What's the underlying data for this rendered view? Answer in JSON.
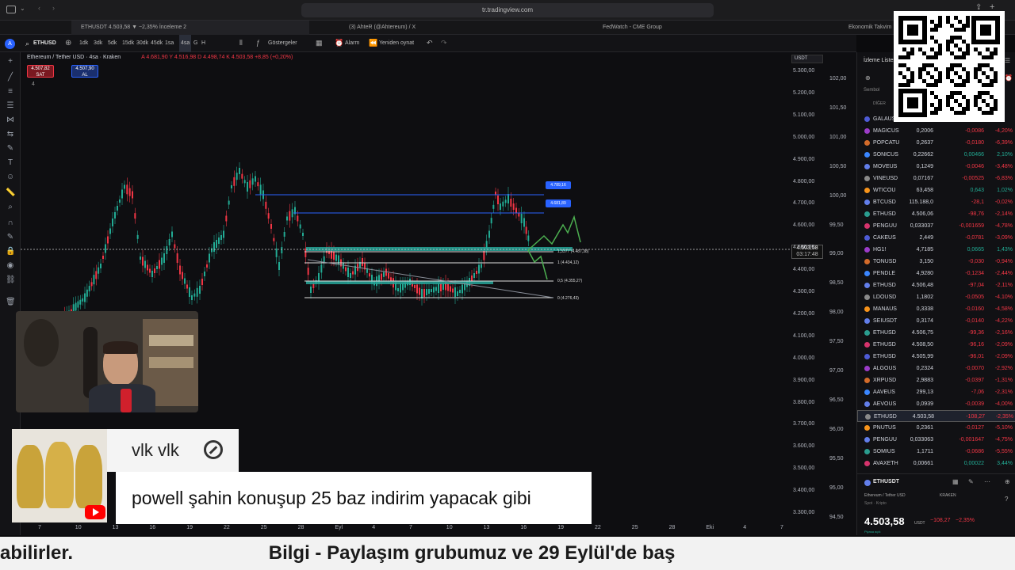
{
  "browser": {
    "url": "tr.tradingview.com",
    "tabs": [
      "ETHUSDT 4.503,58 ▼ −2,35% İnceleme 2",
      "(3) AhteR (@Ahtereum) / X",
      "FedWatch - CME Group",
      "Ekonomik Takvim"
    ]
  },
  "toolbar": {
    "symbol": "ETHUSD",
    "intervals": [
      "1dk",
      "3dk",
      "5dk",
      "15dk",
      "30dk",
      "45dk",
      "1sa",
      "4sa",
      "G",
      "H"
    ],
    "active_interval": "4sa",
    "indicators_label": "Göstergeler",
    "alarm_label": "Alarm",
    "replay_label": "Yeniden oynat"
  },
  "chart": {
    "title": "Ethereum / Tether USD · 4sa · Kraken",
    "ohlc": "A 4.681,90 Y 4.516,98 D 4.498,74 K 4.503,58 +8,85 (+0,20%)",
    "sell_price": "4.507,82",
    "sell_label": "SAT",
    "buy_price": "4.507,90",
    "buy_label": "AL",
    "vol_label": "4",
    "currency_select": "USDT",
    "current_price": "4.503,58",
    "countdown": "03:17:48",
    "upper_badge_1": "4.789,16",
    "upper_badge_2": "4.681,89",
    "fib_labels": [
      "1,3377 (4.487,38)",
      "1 (4.434,12)",
      "0,5 (4.355,27)",
      "0 (4.276,43)"
    ],
    "price_axis": [
      "5.300,00",
      "5.200,00",
      "5.100,00",
      "5.000,00",
      "4.900,00",
      "4.800,00",
      "4.700,00",
      "4.600,00",
      "4.500,00",
      "4.400,00",
      "4.300,00",
      "4.200,00",
      "4.100,00",
      "4.000,00",
      "3.900,00",
      "3.800,00",
      "3.700,00",
      "3.600,00",
      "3.500,00",
      "3.400,00",
      "3.300,00"
    ],
    "dxy_axis": [
      "102,00",
      "101,50",
      "101,00",
      "100,50",
      "100,00",
      "99,50",
      "99,00",
      "98,50",
      "98,00",
      "97,50",
      "97,00",
      "96,50",
      "96,00",
      "95,50",
      "95,00",
      "94,50"
    ],
    "time_axis": [
      "7",
      "10",
      "13",
      "16",
      "19",
      "22",
      "25",
      "28",
      "Eyl",
      "4",
      "7",
      "10",
      "13",
      "16",
      "19",
      "22",
      "25",
      "28",
      "Eki",
      "4",
      "7"
    ],
    "colors": {
      "up": "#22ab94",
      "down": "#f23645",
      "line_blue": "#2962ff",
      "teal_band": "#26a69a",
      "projection": "#4caf50"
    }
  },
  "watchlist": {
    "title": "İzleme Listesi",
    "col_symbol": "Sembol",
    "group": "DİĞER",
    "rows": [
      {
        "sym": "GALAUS",
        "last": "",
        "chg": "",
        "pct": "",
        "dir": "neg"
      },
      {
        "sym": "MAGICUS",
        "last": "0,2006",
        "chg": "-0,0086",
        "pct": "-4,20%",
        "dir": "neg"
      },
      {
        "sym": "POPCATU",
        "last": "0,2637",
        "chg": "-0,0180",
        "pct": "-6,39%",
        "dir": "neg"
      },
      {
        "sym": "SONICUS",
        "last": "0,22662",
        "chg": "0,00466",
        "pct": "2,10%",
        "dir": "pos"
      },
      {
        "sym": "MOVEUS",
        "last": "0,1249",
        "chg": "-0,0046",
        "pct": "-3,48%",
        "dir": "neg"
      },
      {
        "sym": "VINEUSD",
        "last": "0,07167",
        "chg": "-0,00525",
        "pct": "-6,83%",
        "dir": "neg"
      },
      {
        "sym": "WTICOU",
        "last": "63,458",
        "chg": "0,643",
        "pct": "1,02%",
        "dir": "pos"
      },
      {
        "sym": "BTCUSD",
        "last": "115.188,0",
        "chg": "-28,1",
        "pct": "-0,02%",
        "dir": "neg"
      },
      {
        "sym": "ETHUSD",
        "last": "4.506,06",
        "chg": "-98,76",
        "pct": "-2,14%",
        "dir": "neg"
      },
      {
        "sym": "PENGUU",
        "last": "0,033037",
        "chg": "-0,001659",
        "pct": "-4,78%",
        "dir": "neg"
      },
      {
        "sym": "CAKEUS",
        "last": "2,449",
        "chg": "-0,0781",
        "pct": "-3,09%",
        "dir": "neg"
      },
      {
        "sym": "HG1!",
        "last": "4,7185",
        "chg": "0,0665",
        "pct": "1,43%",
        "dir": "pos"
      },
      {
        "sym": "TONUSD",
        "last": "3,150",
        "chg": "-0,030",
        "pct": "-0,94%",
        "dir": "neg"
      },
      {
        "sym": "PENDLE",
        "last": "4,9280",
        "chg": "-0,1234",
        "pct": "-2,44%",
        "dir": "neg"
      },
      {
        "sym": "ETHUSD",
        "last": "4.506,48",
        "chg": "-97,04",
        "pct": "-2,11%",
        "dir": "neg"
      },
      {
        "sym": "LDOUSD",
        "last": "1,1802",
        "chg": "-0,0505",
        "pct": "-4,10%",
        "dir": "neg"
      },
      {
        "sym": "MANAUS",
        "last": "0,3338",
        "chg": "-0,0160",
        "pct": "-4,58%",
        "dir": "neg"
      },
      {
        "sym": "SEIUSDT",
        "last": "0,3174",
        "chg": "-0,0140",
        "pct": "-4,22%",
        "dir": "neg"
      },
      {
        "sym": "ETHUSD",
        "last": "4.506,75",
        "chg": "-99,36",
        "pct": "-2,16%",
        "dir": "neg"
      },
      {
        "sym": "ETHUSD",
        "last": "4.508,50",
        "chg": "-96,16",
        "pct": "-2,09%",
        "dir": "neg"
      },
      {
        "sym": "ETHUSD",
        "last": "4.505,99",
        "chg": "-96,01",
        "pct": "-2,09%",
        "dir": "neg"
      },
      {
        "sym": "ALGOUS",
        "last": "0,2324",
        "chg": "-0,0070",
        "pct": "-2,92%",
        "dir": "neg"
      },
      {
        "sym": "XRPUSD",
        "last": "2,9883",
        "chg": "-0,0397",
        "pct": "-1,31%",
        "dir": "neg"
      },
      {
        "sym": "AAVEUS",
        "last": "299,13",
        "chg": "-7,06",
        "pct": "-2,31%",
        "dir": "neg"
      },
      {
        "sym": "AEVOUS",
        "last": "0,0939",
        "chg": "-0,0039",
        "pct": "-4,00%",
        "dir": "neg"
      },
      {
        "sym": "ETHUSD",
        "last": "4.503,58",
        "chg": "-108,27",
        "pct": "-2,35%",
        "dir": "neg"
      },
      {
        "sym": "PNUTUS",
        "last": "0,2361",
        "chg": "-0,0127",
        "pct": "-5,10%",
        "dir": "neg"
      },
      {
        "sym": "PENGUU",
        "last": "0,033063",
        "chg": "-0,001647",
        "pct": "-4,75%",
        "dir": "neg"
      },
      {
        "sym": "SOMIUS",
        "last": "1,1711",
        "chg": "-0,0686",
        "pct": "-5,55%",
        "dir": "neg"
      },
      {
        "sym": "AVAXETH",
        "last": "0,00661",
        "chg": "0,00022",
        "pct": "3,44%",
        "dir": "pos"
      }
    ],
    "detail": {
      "symbol": "ETHUSDT",
      "name": "Ethereum / Tether USD",
      "exchange": "KRAKEN",
      "type": "Spot · Kripto",
      "price": "4.503,58",
      "currency": "USDT",
      "change": "−108,27",
      "pct": "−2,35%",
      "market_status": "Piyasa açık"
    }
  },
  "stream": {
    "chat_user": "vlk vlk",
    "chat_message": "powell şahin konuşup 25 baz indirim yapacak gibi",
    "ticker_text": "abilirler.                                     Bilgi - Paylaşım grubumuz ve 29 Eylül'de baş"
  }
}
